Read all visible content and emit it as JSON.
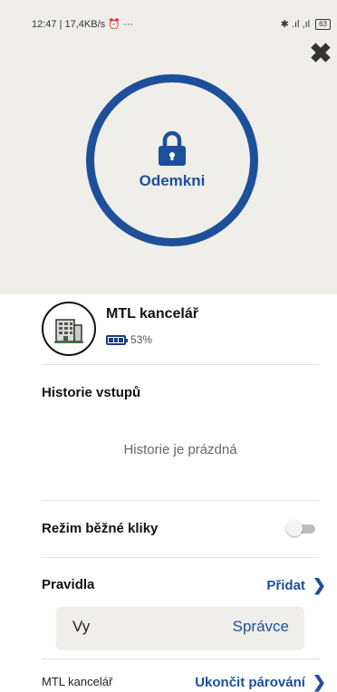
{
  "status_bar": {
    "time_info": "12:47 | 17,4KB/s",
    "more": "···",
    "signal": "✱ .ıl ,ıl",
    "battery": "63"
  },
  "unlock": {
    "label": "Odemkni"
  },
  "close_glyph": "✖",
  "device": {
    "name": "MTL kancelář",
    "battery_percent": "53%",
    "battery_level": 0.53
  },
  "history": {
    "title": "Historie vstupů",
    "empty": "Historie je prázdná"
  },
  "mode": {
    "title": "Režim běžné kliky",
    "enabled": false
  },
  "rules": {
    "title": "Pravidla",
    "add_label": "Přidat",
    "items": [
      {
        "user": "Vy",
        "role": "Správce"
      }
    ]
  },
  "footer": {
    "name": "MTL kancelář",
    "unpair_label": "Ukončit párování"
  },
  "colors": {
    "accent": "#1e4f9a",
    "background": "#efeeea",
    "toggle_off": "#bdbdbd"
  },
  "icons": {
    "lock": "lock-icon",
    "close": "close-icon",
    "building": "building-icon",
    "chevron": "chevron-right-icon"
  }
}
